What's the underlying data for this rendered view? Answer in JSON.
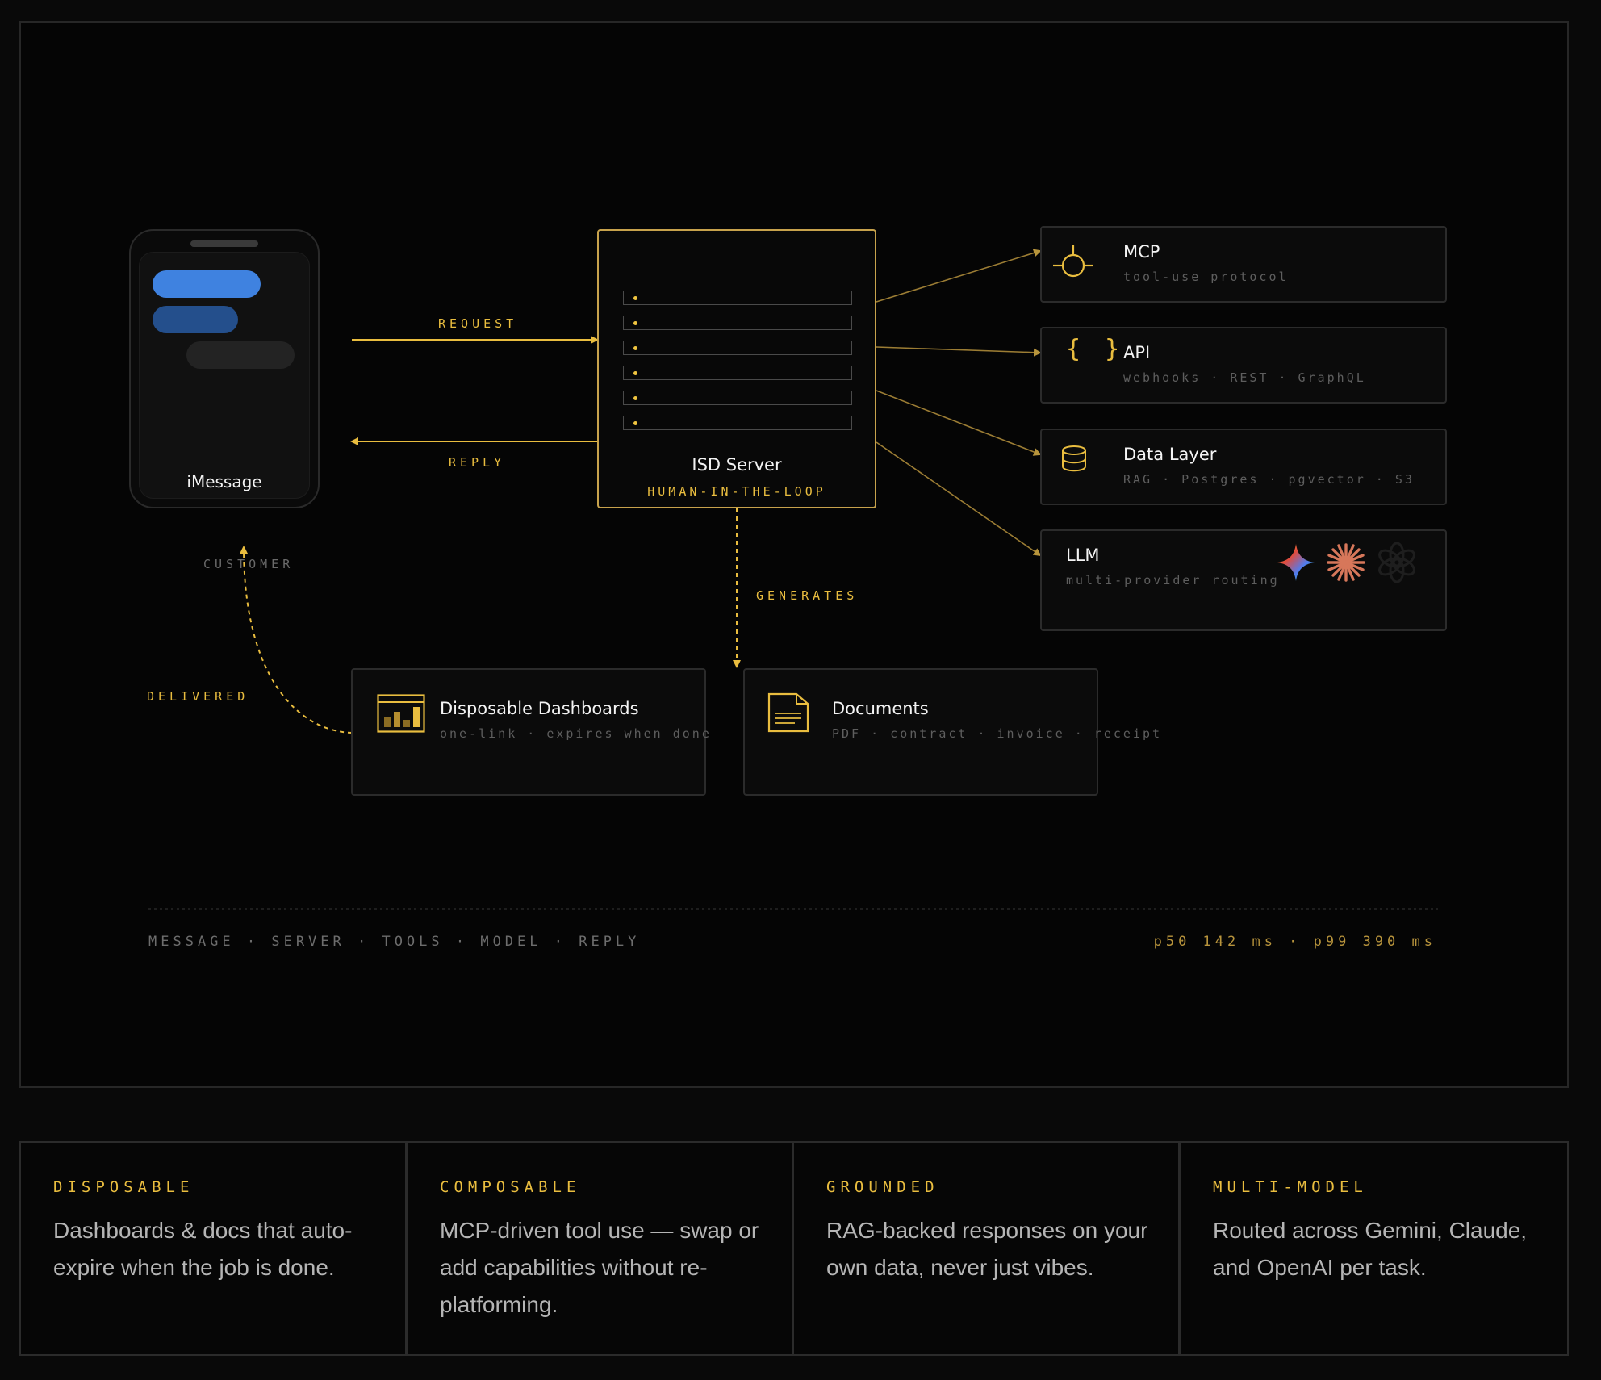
{
  "customer": {
    "app_label": "iMessage",
    "caption": "CUSTOMER"
  },
  "flow": {
    "request": "REQUEST",
    "reply": "REPLY",
    "generates": "GENERATES",
    "delivered": "DELIVERED"
  },
  "server": {
    "title": "ISD Server",
    "subtitle": "HUMAN-IN-THE-LOOP"
  },
  "tools": [
    {
      "title": "MCP",
      "subtitle": "tool-use protocol",
      "icon": "crosshair-icon"
    },
    {
      "title": "API",
      "subtitle": "webhooks · REST · GraphQL",
      "icon": "braces-icon"
    },
    {
      "title": "Data Layer",
      "subtitle": "RAG · Postgres · pgvector · S3",
      "icon": "database-icon"
    },
    {
      "title": "LLM",
      "subtitle": "multi-provider routing",
      "icon": "llm-icon",
      "provider_icons": [
        "gemini-icon",
        "claude-icon",
        "openai-icon"
      ]
    }
  ],
  "outputs": [
    {
      "title": "Disposable Dashboards",
      "subtitle": "one-link · expires when done",
      "icon": "bar-chart-icon"
    },
    {
      "title": "Documents",
      "subtitle": "PDF · contract · invoice · receipt",
      "icon": "document-icon"
    }
  ],
  "footer": {
    "pipeline": "MESSAGE · SERVER · TOOLS · MODEL · REPLY",
    "latency": "p50 142 ms · p99 390 ms"
  },
  "features": [
    {
      "heading": "DISPOSABLE",
      "text": "Dashboards & docs that auto-expire when the job is done."
    },
    {
      "heading": "COMPOSABLE",
      "text": "MCP-driven tool use — swap or add capabilities without re-platforming."
    },
    {
      "heading": "GROUNDED",
      "text": "RAG-backed responses on your own data, never just vibes."
    },
    {
      "heading": "MULTI-MODEL",
      "text": "Routed across Gemini, Claude, and OpenAI per task."
    }
  ],
  "colors": {
    "accent": "#e9bd3f",
    "background": "#050505",
    "border": "#2b2b2b"
  }
}
